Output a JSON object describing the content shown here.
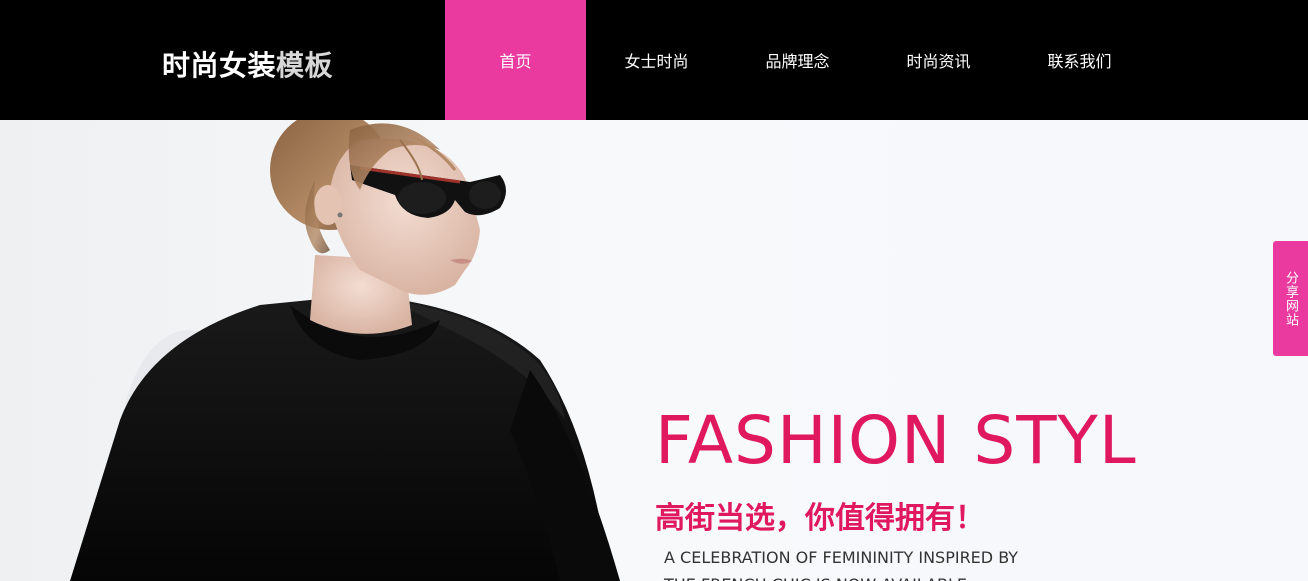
{
  "header": {
    "logo_main": "时尚女装",
    "logo_accent": "模板"
  },
  "nav": {
    "items": [
      {
        "label": "首页",
        "active": true
      },
      {
        "label": "女士时尚",
        "active": false
      },
      {
        "label": "品牌理念",
        "active": false
      },
      {
        "label": "时尚资讯",
        "active": false
      },
      {
        "label": "联系我们",
        "active": false
      }
    ]
  },
  "banner": {
    "headline": "FASHION STYL",
    "subheadline": "高街当选，你值得拥有！",
    "description_line1": "A CELEBRATION OF FEMININITY INSPIRED BY",
    "description_line2": "THE FRENCH CHIC IS NOW AVAILABLE.",
    "model_image": "woman-in-sunglasses-black-sweater"
  },
  "share_tab": {
    "label": "分享网站"
  },
  "colors": {
    "header_bg": "#000000",
    "nav_active": "#ea3a9f",
    "headline": "#e0195f",
    "share_tab": "#ea3a9f"
  }
}
